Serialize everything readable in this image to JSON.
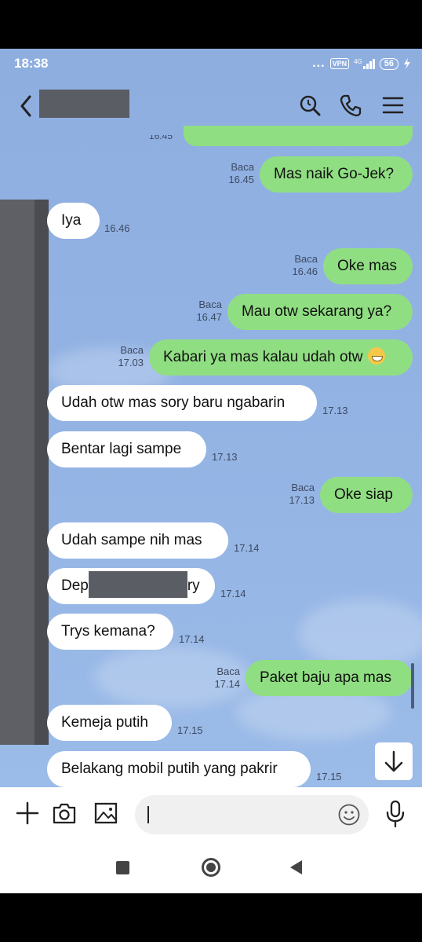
{
  "status": {
    "time": "18:38",
    "dots": "...",
    "vpn": "VPN",
    "network": "4G",
    "battery": "56"
  },
  "header": {
    "contact_name": ""
  },
  "partial": {
    "time": "16.45"
  },
  "messages": [
    {
      "dir": "out",
      "text": "Mas naik Go-Jek?",
      "read": "Baca",
      "time": "16.45"
    },
    {
      "dir": "in",
      "text": "Iya",
      "time": "16.46"
    },
    {
      "dir": "out",
      "text": "Oke mas",
      "read": "Baca",
      "time": "16.46"
    },
    {
      "dir": "out",
      "text": "Mau otw sekarang ya?",
      "read": "Baca",
      "time": "16.47"
    },
    {
      "dir": "out",
      "text": "Kabari ya mas kalau udah otw",
      "read": "Baca",
      "time": "17.03",
      "emoji": "grinning-face"
    },
    {
      "dir": "in",
      "text": "Udah otw mas sory baru ngabarin",
      "time": "17.13"
    },
    {
      "dir": "in",
      "text": "Bentar lagi sampe",
      "time": "17.13"
    },
    {
      "dir": "out",
      "text": "Oke siap",
      "read": "Baca",
      "time": "17.13"
    },
    {
      "dir": "in",
      "text": "Udah sampe nih mas",
      "time": "17.14"
    },
    {
      "dir": "in",
      "text_a": "Dep",
      "text_b": "ry",
      "time": "17.14",
      "redacted": true
    },
    {
      "dir": "in",
      "text": "Trys kemana?",
      "time": "17.14"
    },
    {
      "dir": "out",
      "text": "Paket baju apa mas",
      "read": "Baca",
      "time": "17.14"
    },
    {
      "dir": "in",
      "text": "Kemeja putih",
      "time": "17.15"
    },
    {
      "dir": "in",
      "text": "Belakang mobil putih yang pakrir",
      "time": "17.15"
    }
  ],
  "input": {
    "placeholder": ""
  },
  "colors": {
    "chat_bg": "#93b3e4",
    "outgoing_bubble": "#90de82",
    "incoming_bubble": "#ffffff"
  }
}
